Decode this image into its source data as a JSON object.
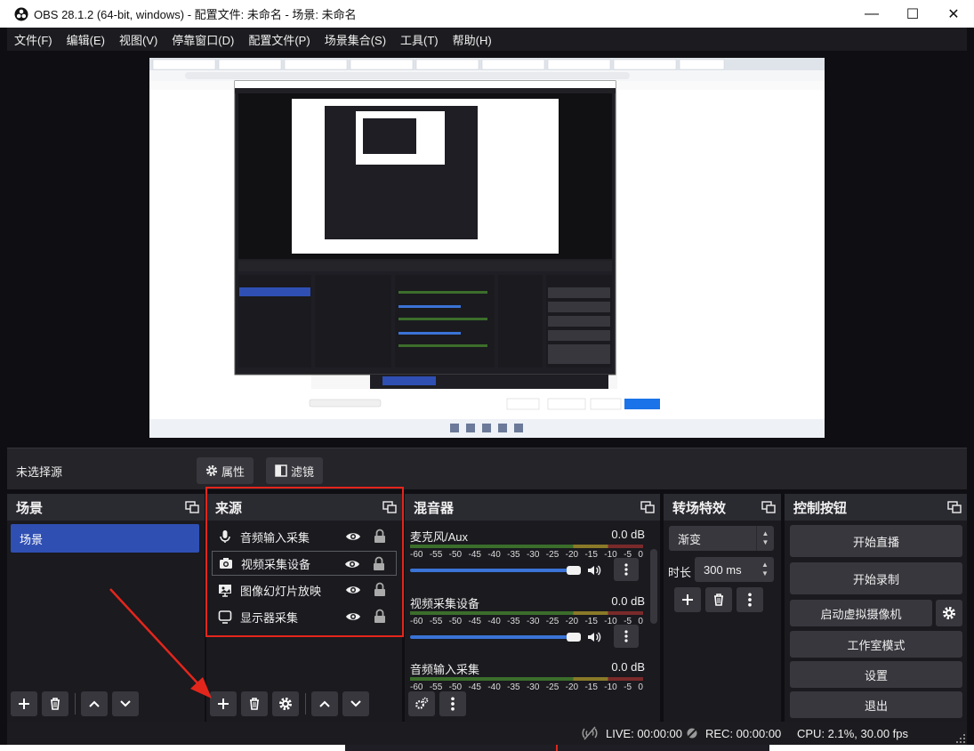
{
  "window": {
    "title": "OBS 28.1.2 (64-bit, windows) - 配置文件: 未命名 - 场景: 未命名",
    "minimize": "—",
    "maximize": "☐",
    "close": "✕"
  },
  "menu": [
    "文件(F)",
    "编辑(E)",
    "视图(V)",
    "停靠窗口(D)",
    "配置文件(P)",
    "场景集合(S)",
    "工具(T)",
    "帮助(H)"
  ],
  "source_toolbar": {
    "no_source": "未选择源",
    "properties": "属性",
    "filters": "滤镜"
  },
  "scenes": {
    "title": "场景",
    "items": [
      "场景"
    ]
  },
  "sources": {
    "title": "来源",
    "items": [
      "音频输入采集",
      "视频采集设备",
      "图像幻灯片放映",
      "显示器采集"
    ]
  },
  "mixer": {
    "title": "混音器",
    "scale": [
      "-60",
      "-55",
      "-50",
      "-45",
      "-40",
      "-35",
      "-30",
      "-25",
      "-20",
      "-15",
      "-10",
      "-5",
      "0"
    ],
    "channels": [
      {
        "name": "麦克风/Aux",
        "db": "0.0 dB"
      },
      {
        "name": "视频采集设备",
        "db": "0.0 dB"
      },
      {
        "name": "音频输入采集",
        "db": "0.0 dB"
      }
    ]
  },
  "transitions": {
    "title": "转场特效",
    "selected": "渐变",
    "duration_label": "时长",
    "duration_value": "300 ms"
  },
  "controls": {
    "title": "控制按钮",
    "start_streaming": "开始直播",
    "start_recording": "开始录制",
    "virtual_camera": "启动虚拟摄像机",
    "studio_mode": "工作室模式",
    "settings": "设置",
    "exit": "退出"
  },
  "status": {
    "live": "LIVE: 00:00:00",
    "rec": "REC: 00:00:00",
    "cpu": "CPU: 2.1%, 30.00 fps"
  },
  "colors": {
    "accent": "#2f4fb3",
    "highlight_box": "#e3261c",
    "dock_bg": "#1e1e24",
    "header_bg": "#2a2a31"
  }
}
